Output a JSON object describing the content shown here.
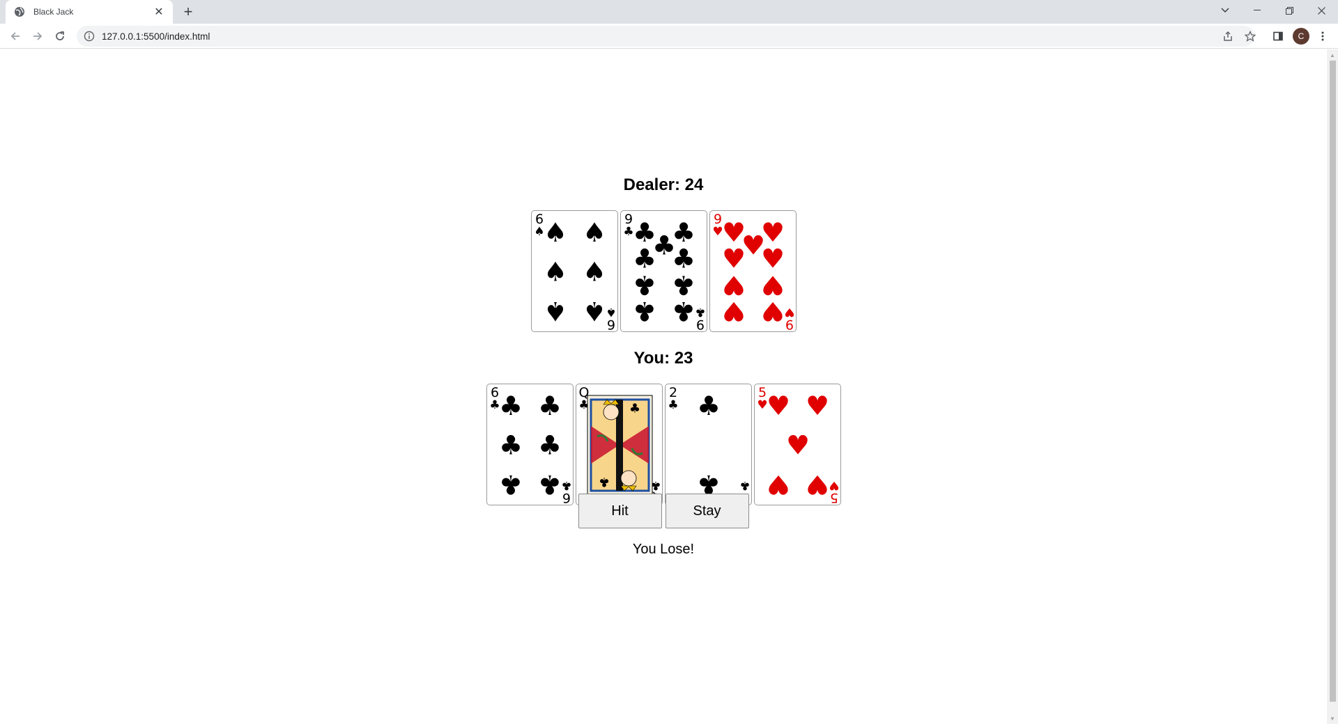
{
  "browser": {
    "tab_title": "Black Jack",
    "url": "127.0.0.1:5500/index.html",
    "profile_initial": "C"
  },
  "game": {
    "dealer_label": "Dealer: 24",
    "player_label": "You: 23",
    "hit_label": "Hit",
    "stay_label": "Stay",
    "result": "You Lose!",
    "dealer_cards": [
      {
        "rank": "6",
        "suit": "spades"
      },
      {
        "rank": "9",
        "suit": "clubs"
      },
      {
        "rank": "9",
        "suit": "hearts"
      }
    ],
    "player_cards": [
      {
        "rank": "6",
        "suit": "clubs"
      },
      {
        "rank": "Q",
        "suit": "clubs"
      },
      {
        "rank": "2",
        "suit": "clubs"
      },
      {
        "rank": "5",
        "suit": "hearts"
      }
    ],
    "colors": {
      "red_suit": "#e00000",
      "black_suit": "#000000"
    }
  }
}
